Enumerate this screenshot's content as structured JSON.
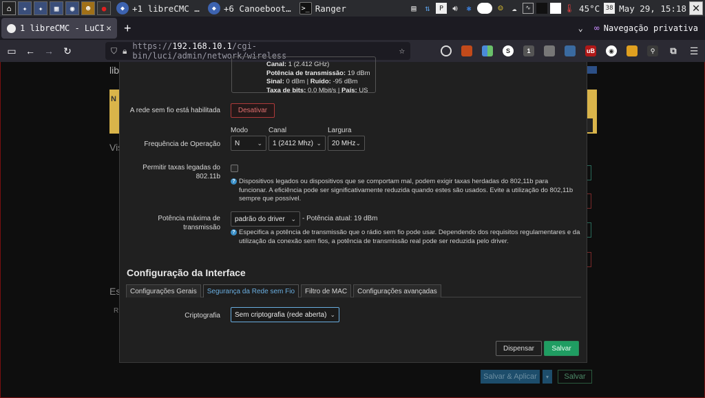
{
  "taskbar": {
    "tasks": [
      {
        "label": "+1 libreCMC …"
      },
      {
        "label": "+6 Canoeboot…"
      },
      {
        "label": "Ranger"
      }
    ],
    "temperature": "45°C",
    "clock": "May 29, 15:18",
    "calendar_day": "38"
  },
  "browser": {
    "tab_title": "1 libreCMC - LuCI",
    "private_label": "Navegação privativa",
    "url_prefix": "https://",
    "url_host": "192.168.10.1",
    "url_path": "/cgi-bin/luci/admin/network/wireless"
  },
  "background_page": {
    "title": "libr",
    "warn_letter": "N",
    "section1": "Vis",
    "section2": "Es",
    "row_letter": "R",
    "save_apply_label": "Salvar & Aplicar",
    "save_label": "Salvar"
  },
  "modal": {
    "scan": {
      "channel_label": "Canal:",
      "channel_value": "1 (2.412 GHz)",
      "tx_label": "Potência de transmissão:",
      "tx_value": "19 dBm",
      "signal_label": "Sinal:",
      "signal_value": "0 dBm",
      "noise_label": "Ruído:",
      "noise_value": "-95 dBm",
      "bitrate_label": "Taxa de bits:",
      "bitrate_value": "0.0 Mbit/s",
      "country_label": "País:",
      "country_value": "US"
    },
    "wireless_enabled_label": "A rede sem fio está habilitada",
    "disable_button": "Desativar",
    "freq_label": "Frequência de Operação",
    "mode_label": "Modo",
    "mode_value": "N",
    "channel_label": "Canal",
    "channel_value": "1 (2412 Mhz)",
    "width_label": "Largura",
    "width_value": "20 MHz",
    "legacy_label": "Permitir taxas legadas do 802.11b",
    "legacy_help": "Dispositivos legados ou dispositivos que se comportam mal, podem exigir taxas herdadas do 802,11b para funcionar. A eficiência pode ser significativamente reduzida quando estes são usados. Evite a utilização do 802,11b sempre que possível.",
    "maxpower_label": "Potência máxima de transmissão",
    "maxpower_value": "padrão do driver",
    "current_power": "- Potência atual: 19 dBm",
    "maxpower_help": "Especifica a potência de transmissão que o rádio sem fio pode usar. Dependendo dos requisitos regulamentares e da utilização da conexão sem fios, a potência de transmissão real pode ser reduzida pelo driver.",
    "interface_title": "Configuração da Interface",
    "tabs": [
      {
        "label": "Configurações Gerais"
      },
      {
        "label": "Segurança da Rede sem Fio"
      },
      {
        "label": "Filtro de MAC"
      },
      {
        "label": "Configurações avançadas"
      }
    ],
    "active_tab_index": 1,
    "encryption_label": "Criptografia",
    "encryption_value": "Sem criptografia (rede aberta)",
    "dismiss_button": "Dispensar",
    "save_button": "Salvar"
  },
  "colors": {
    "accent_blue": "#6aaee0",
    "save_green": "#1f9d62",
    "danger_red": "#b03a3a",
    "page_border": "#7a1010"
  }
}
